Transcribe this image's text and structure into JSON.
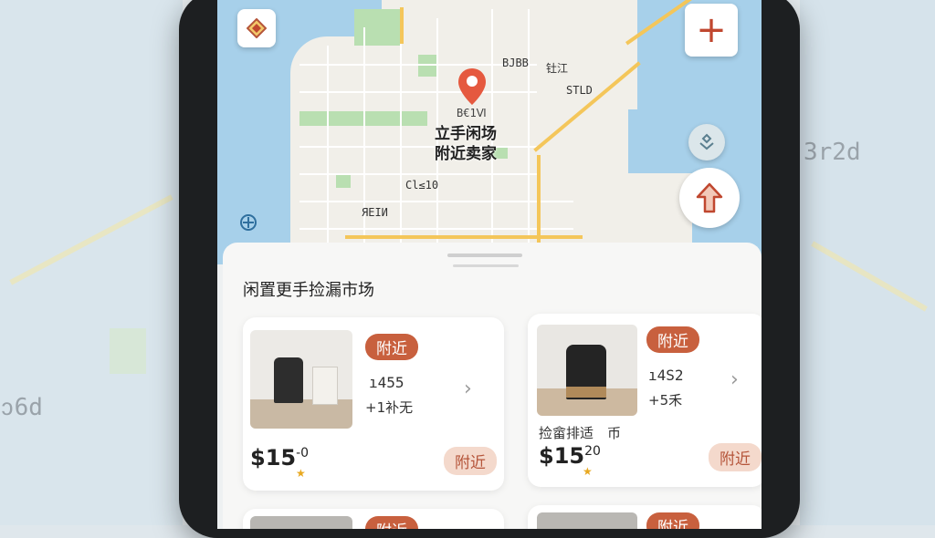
{
  "map": {
    "pin_title_line1": "立手闲场",
    "pin_title_line2": "附近卖家",
    "pin_label": "B€1Ⅵ",
    "labels": [
      "BJBB",
      "钍江",
      "STLD",
      "Cl≤10",
      "ЯЕIИ"
    ],
    "right_bg_text": "3r2d",
    "left_bg_text": "ↄ6d"
  },
  "controls": {
    "compass": "compass-icon",
    "add": "+",
    "layers_icon": "layers-icon",
    "navigate": "↑",
    "location_icon": "location-icon"
  },
  "sheet": {
    "title": "闲置更手捡漏市场",
    "cards": [
      {
        "badge": "附近",
        "spec_line1": "ı455",
        "spec_line2": "+1补无",
        "price_main": "$15",
        "price_sup": "-0",
        "tag": "附近"
      },
      {
        "badge": "附近",
        "spec_line1": "ı4S2",
        "spec_line2": "+5禾",
        "name": "捡畲排适　币",
        "price_main": "$15",
        "price_sup": "20",
        "tag": "附近"
      },
      {
        "badge": "附近"
      },
      {
        "badge": "附近"
      }
    ]
  },
  "colors": {
    "accent": "#c8603e",
    "accent_soft": "#f4d9cc",
    "water": "#a7d0ea",
    "highway": "#f4c65a"
  }
}
